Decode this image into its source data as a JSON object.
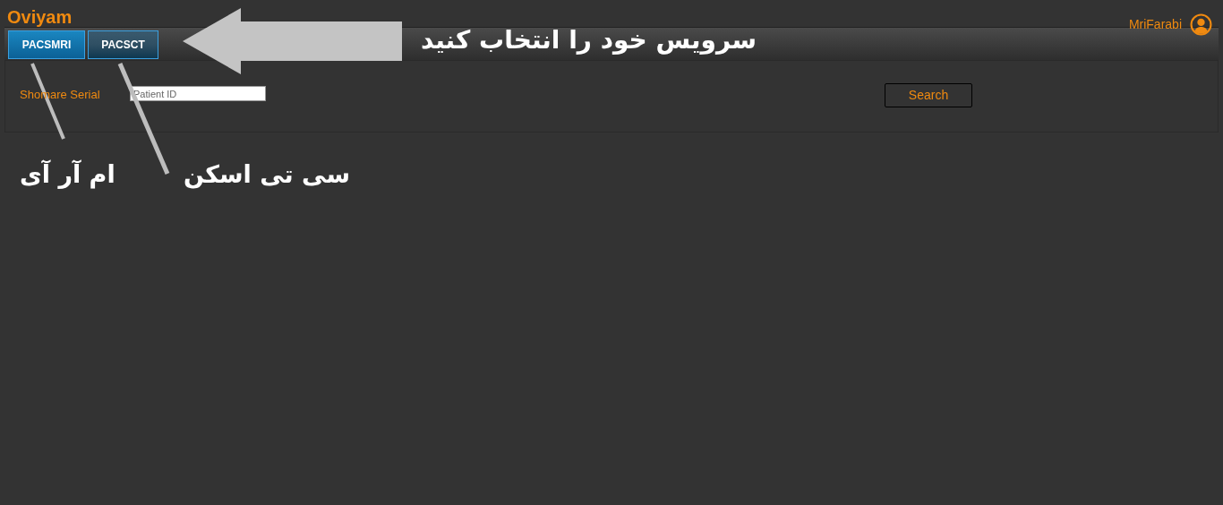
{
  "header": {
    "logo": "Oviyam",
    "user": "MriFarabi"
  },
  "tabs": [
    {
      "label": "PACSMRI",
      "selected": true
    },
    {
      "label": "PACSCT",
      "selected": false
    }
  ],
  "search_form": {
    "label": "Shomare Serial",
    "field": {
      "placeholder": "Patient ID"
    },
    "button": "Search"
  },
  "annotations": {
    "arrow_caption": "سرویس خود را انتخاب کنید",
    "mri_caption": "ام آر آی",
    "ct_caption": "سی تی اسکن"
  }
}
